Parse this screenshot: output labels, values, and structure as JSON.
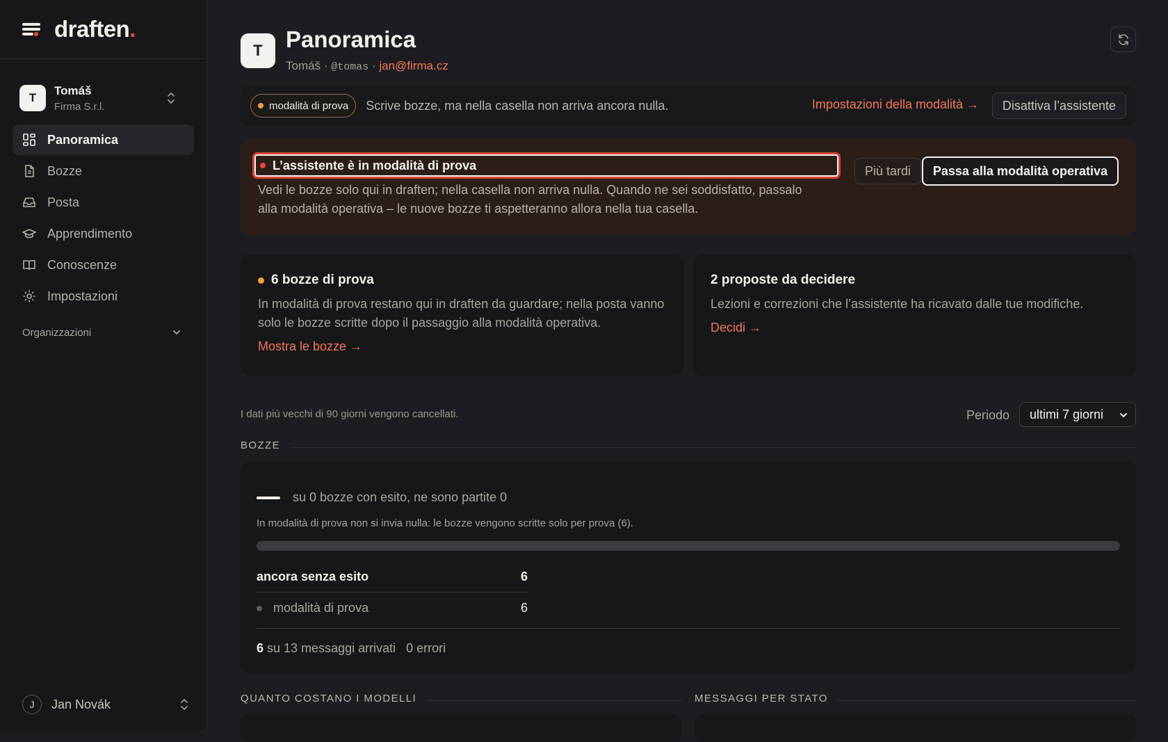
{
  "brand": {
    "name": "draften",
    "dot": "."
  },
  "account": {
    "initial": "T",
    "name": "Tomáš",
    "org": "Firma S.r.l."
  },
  "nav": [
    {
      "label": "Panoramica",
      "icon": "grid-icon",
      "active": true
    },
    {
      "label": "Bozze",
      "icon": "document-icon"
    },
    {
      "label": "Posta",
      "icon": "inbox-icon"
    },
    {
      "label": "Apprendimento",
      "icon": "graduation-cap-icon"
    },
    {
      "label": "Conoscenze",
      "icon": "book-icon"
    },
    {
      "label": "Impostazioni",
      "icon": "gear-icon"
    }
  ],
  "organizations_label": "Organizzazioni",
  "user": {
    "initial": "J",
    "name": "Jan Novák"
  },
  "header": {
    "initial": "T",
    "title": "Panoramica",
    "name": "Tomáš",
    "sep": "·",
    "handle": "@tomas",
    "email": "jan@firma.cz"
  },
  "mode_bar": {
    "badge": "modalità di prova",
    "message": "Scrive bozze, ma nella casella non arriva ancora nulla.",
    "settings_link": "Impostazioni della modalità →",
    "disable_button": "Disattiva l’assistente"
  },
  "alert": {
    "title": "L’assistente è in modalità di prova",
    "text": "Vedi le bozze solo qui in draften; nella casella non arriva nulla. Quando ne sei soddisfatto, passalo alla modalità operativa – le nuove bozze ti aspetteranno allora nella tua casella.",
    "later_button": "Più tardi",
    "primary_button": "Passa alla modalità operativa"
  },
  "cards": [
    {
      "title": "6 bozze di prova",
      "text": "In modalità di prova restano qui in draften da guardare; nella posta vanno solo le bozze scritte dopo il passaggio alla modalità operativa.",
      "link": "Mostra le bozze →"
    },
    {
      "title": "2 proposte da decidere",
      "text": "Lezioni e correzioni che l’assistente ha ricavato dalle tue modifiche.",
      "link": "Decidi →"
    }
  ],
  "retention_note": "I dati più vecchi di 90 giorni vengono cancellati.",
  "period": {
    "label": "Periodo",
    "value": "ultimi 7 giorni"
  },
  "sections": {
    "drafts": "BOZZE",
    "models_cost": "QUANTO COSTANO I MODELLI",
    "messages_by_state": "MESSAGGI PER STATO"
  },
  "drafts_stats": {
    "summary": "su 0 bozze con esito, ne sono partite 0",
    "note": "In modalità di prova non si invia nulla: le bozze vengono scritte solo per prova (6).",
    "sent_fraction": 0,
    "table_head": {
      "label": "ancora senza esito",
      "value": "6"
    },
    "table_rows": [
      {
        "label": "modalità di prova",
        "value": "6"
      }
    ],
    "foot": {
      "count": "6",
      "text": "su 13 messaggi arrivati",
      "errors": "0 errori"
    }
  }
}
